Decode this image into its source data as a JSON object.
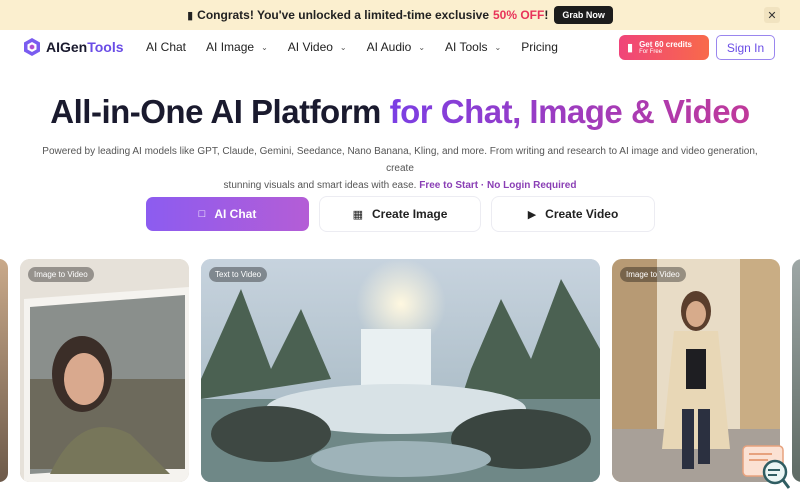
{
  "promo": {
    "gift_icon": "gift-icon",
    "text": "Congrats! You've unlocked a limited-time exclusive",
    "offer": "50% OFF",
    "exclaim": "!",
    "cta": "Grab Now",
    "close_icon": "close-icon"
  },
  "nav": {
    "brand": "AIGen",
    "brand_accent": "Tools",
    "links": [
      {
        "label": "AI Chat",
        "has_dropdown": false
      },
      {
        "label": "AI Image",
        "has_dropdown": true
      },
      {
        "label": "AI Video",
        "has_dropdown": true
      },
      {
        "label": "AI Audio",
        "has_dropdown": true
      },
      {
        "label": "AI Tools",
        "has_dropdown": true
      },
      {
        "label": "Pricing",
        "has_dropdown": false
      }
    ],
    "credits_title": "Get 60 credits",
    "credits_sub": "For Free",
    "sign_in": "Sign In"
  },
  "hero": {
    "title_plain": "All-in-One AI Platform",
    "title_accent": "for Chat, Image & Video",
    "subtitle_line1": "Powered by leading AI models like GPT, Claude, Gemini, Seedance, Nano Banana, Kling, and more. From writing and research to AI image and video generation, create",
    "subtitle_line2": "stunning visuals and smart ideas with ease.",
    "subtitle_free": "Free to Start · No Login Required"
  },
  "cta": {
    "chat": "AI Chat",
    "image": "Create Image",
    "video": "Create Video"
  },
  "showcase": [
    {
      "label": "Image to Video"
    },
    {
      "label": "Text to Video"
    },
    {
      "label": "Image to Video"
    }
  ],
  "colors": {
    "brand_purple": "#6a4de6",
    "promo_bg": "#fbefcf",
    "offer_red": "#e8335a",
    "credits_gradient_start": "#f0447a",
    "credits_gradient_end": "#f86a4a"
  }
}
